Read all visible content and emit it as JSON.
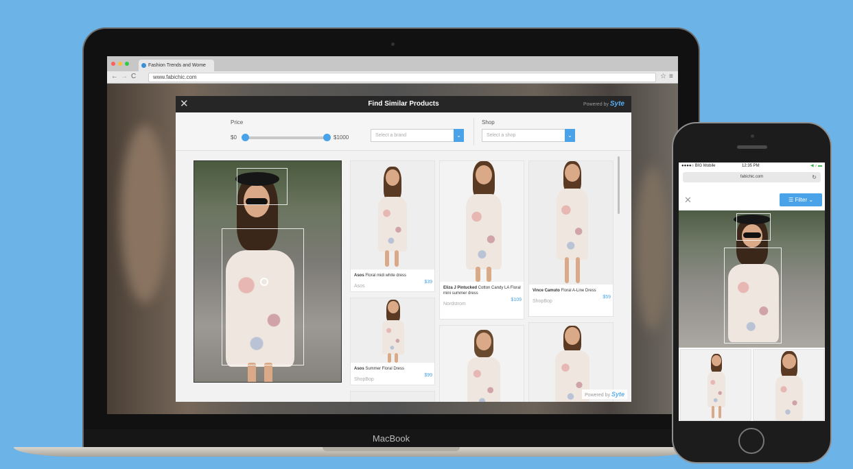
{
  "browser": {
    "tab_title": "Fashion Trends and Wome",
    "url": "www.fabichic.com",
    "traffic_colors": [
      "#fc605b",
      "#fdbc40",
      "#34c84a"
    ]
  },
  "modal": {
    "title": "Find Similar Products",
    "powered_prefix": "Powered by",
    "powered_brand": "Syte",
    "price_label": "Price",
    "price_min": "$0",
    "price_max": "$1000",
    "price_range_fraction": [
      0.0,
      1.0
    ],
    "brand_placeholder": "Select a brand",
    "shop_label": "Shop",
    "shop_placeholder": "Select a shop"
  },
  "products": [
    {
      "brand": "Asos",
      "name": "Floral midi white dress",
      "shop": "Asos",
      "price": "$39"
    },
    {
      "brand": "Eliza J Pintucked",
      "name": "Cotton Candy LA Floral mini summer dress",
      "shop": "Nordstrom",
      "price": "$109"
    },
    {
      "brand": "Vince Camuto",
      "name": "Floral A-Line Dress",
      "shop": "ShopBop",
      "price": "$59"
    },
    {
      "brand": "Asos",
      "name": "Summer Floral Dress",
      "shop": "ShopBop",
      "price": "$99"
    }
  ],
  "laptop_label": "MacBook",
  "phone": {
    "carrier": "●●●●○ BIG Mobile",
    "time": "12:35 PM",
    "battery": "◀ ♪ ▬",
    "url": "fabichic.com",
    "filter_label": "Filter"
  },
  "accent_color": "#4aa3e8",
  "background_color": "#6cb4e8"
}
